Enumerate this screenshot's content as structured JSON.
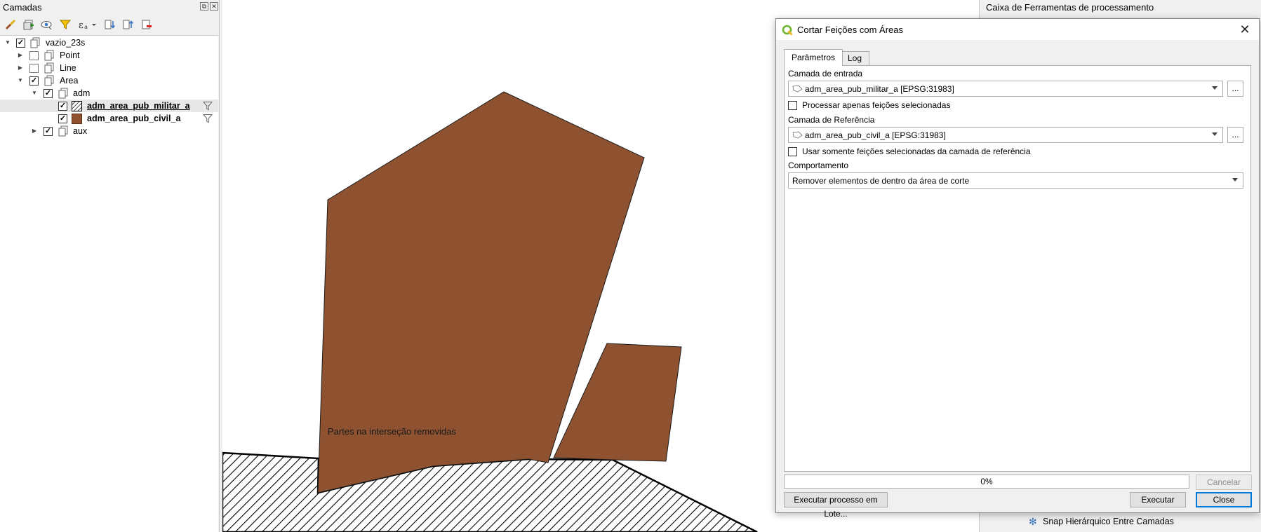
{
  "layers_panel": {
    "title": "Camadas",
    "panel_buttons": [
      "⧉",
      "✕"
    ],
    "tree": [
      {
        "label": "vazio_23s",
        "checked": true,
        "expanded": true,
        "kind": "group"
      },
      {
        "label": "Point",
        "checked": false,
        "expanded": false,
        "kind": "group"
      },
      {
        "label": "Line",
        "checked": false,
        "expanded": false,
        "kind": "group"
      },
      {
        "label": "Area",
        "checked": true,
        "expanded": true,
        "kind": "group"
      },
      {
        "label": "adm",
        "checked": true,
        "expanded": true,
        "kind": "group"
      },
      {
        "label": "adm_area_pub_militar_a",
        "checked": true,
        "kind": "layer",
        "style": "hatch",
        "selected": true,
        "filter": true
      },
      {
        "label": "adm_area_pub_civil_a",
        "checked": true,
        "kind": "layer",
        "style": "brown",
        "filter": true
      },
      {
        "label": "aux",
        "checked": true,
        "expanded": false,
        "kind": "group"
      }
    ]
  },
  "map": {
    "label": "Partes na interseção removidas",
    "fill_color": "#8e5231"
  },
  "toolbox": {
    "title": "Caixa de Ferramentas de processamento",
    "visible_item": "Snap Hierárquico Entre Camadas"
  },
  "dialog": {
    "title": "Cortar Feições com Áreas",
    "close_glyph": "✕",
    "tabs": [
      "Parâmetros",
      "Log"
    ],
    "input_layer": {
      "label": "Camada de entrada",
      "value": "adm_area_pub_militar_a [EPSG:31983]",
      "dots": "..."
    },
    "only_selected": {
      "label": "Processar apenas feições selecionadas",
      "checked": false
    },
    "reference_layer": {
      "label": "Camada de Referência",
      "value": "adm_area_pub_civil_a [EPSG:31983]",
      "dots": "..."
    },
    "only_selected_ref": {
      "label": "Usar somente feições selecionadas da camada de referência",
      "checked": false
    },
    "behavior": {
      "label": "Comportamento",
      "value": "Remover elementos de dentro da área de corte"
    },
    "progress": "0%",
    "buttons": {
      "cancel": "Cancelar",
      "batch": "Executar processo em Lote...",
      "run": "Executar",
      "close": "Close"
    }
  }
}
